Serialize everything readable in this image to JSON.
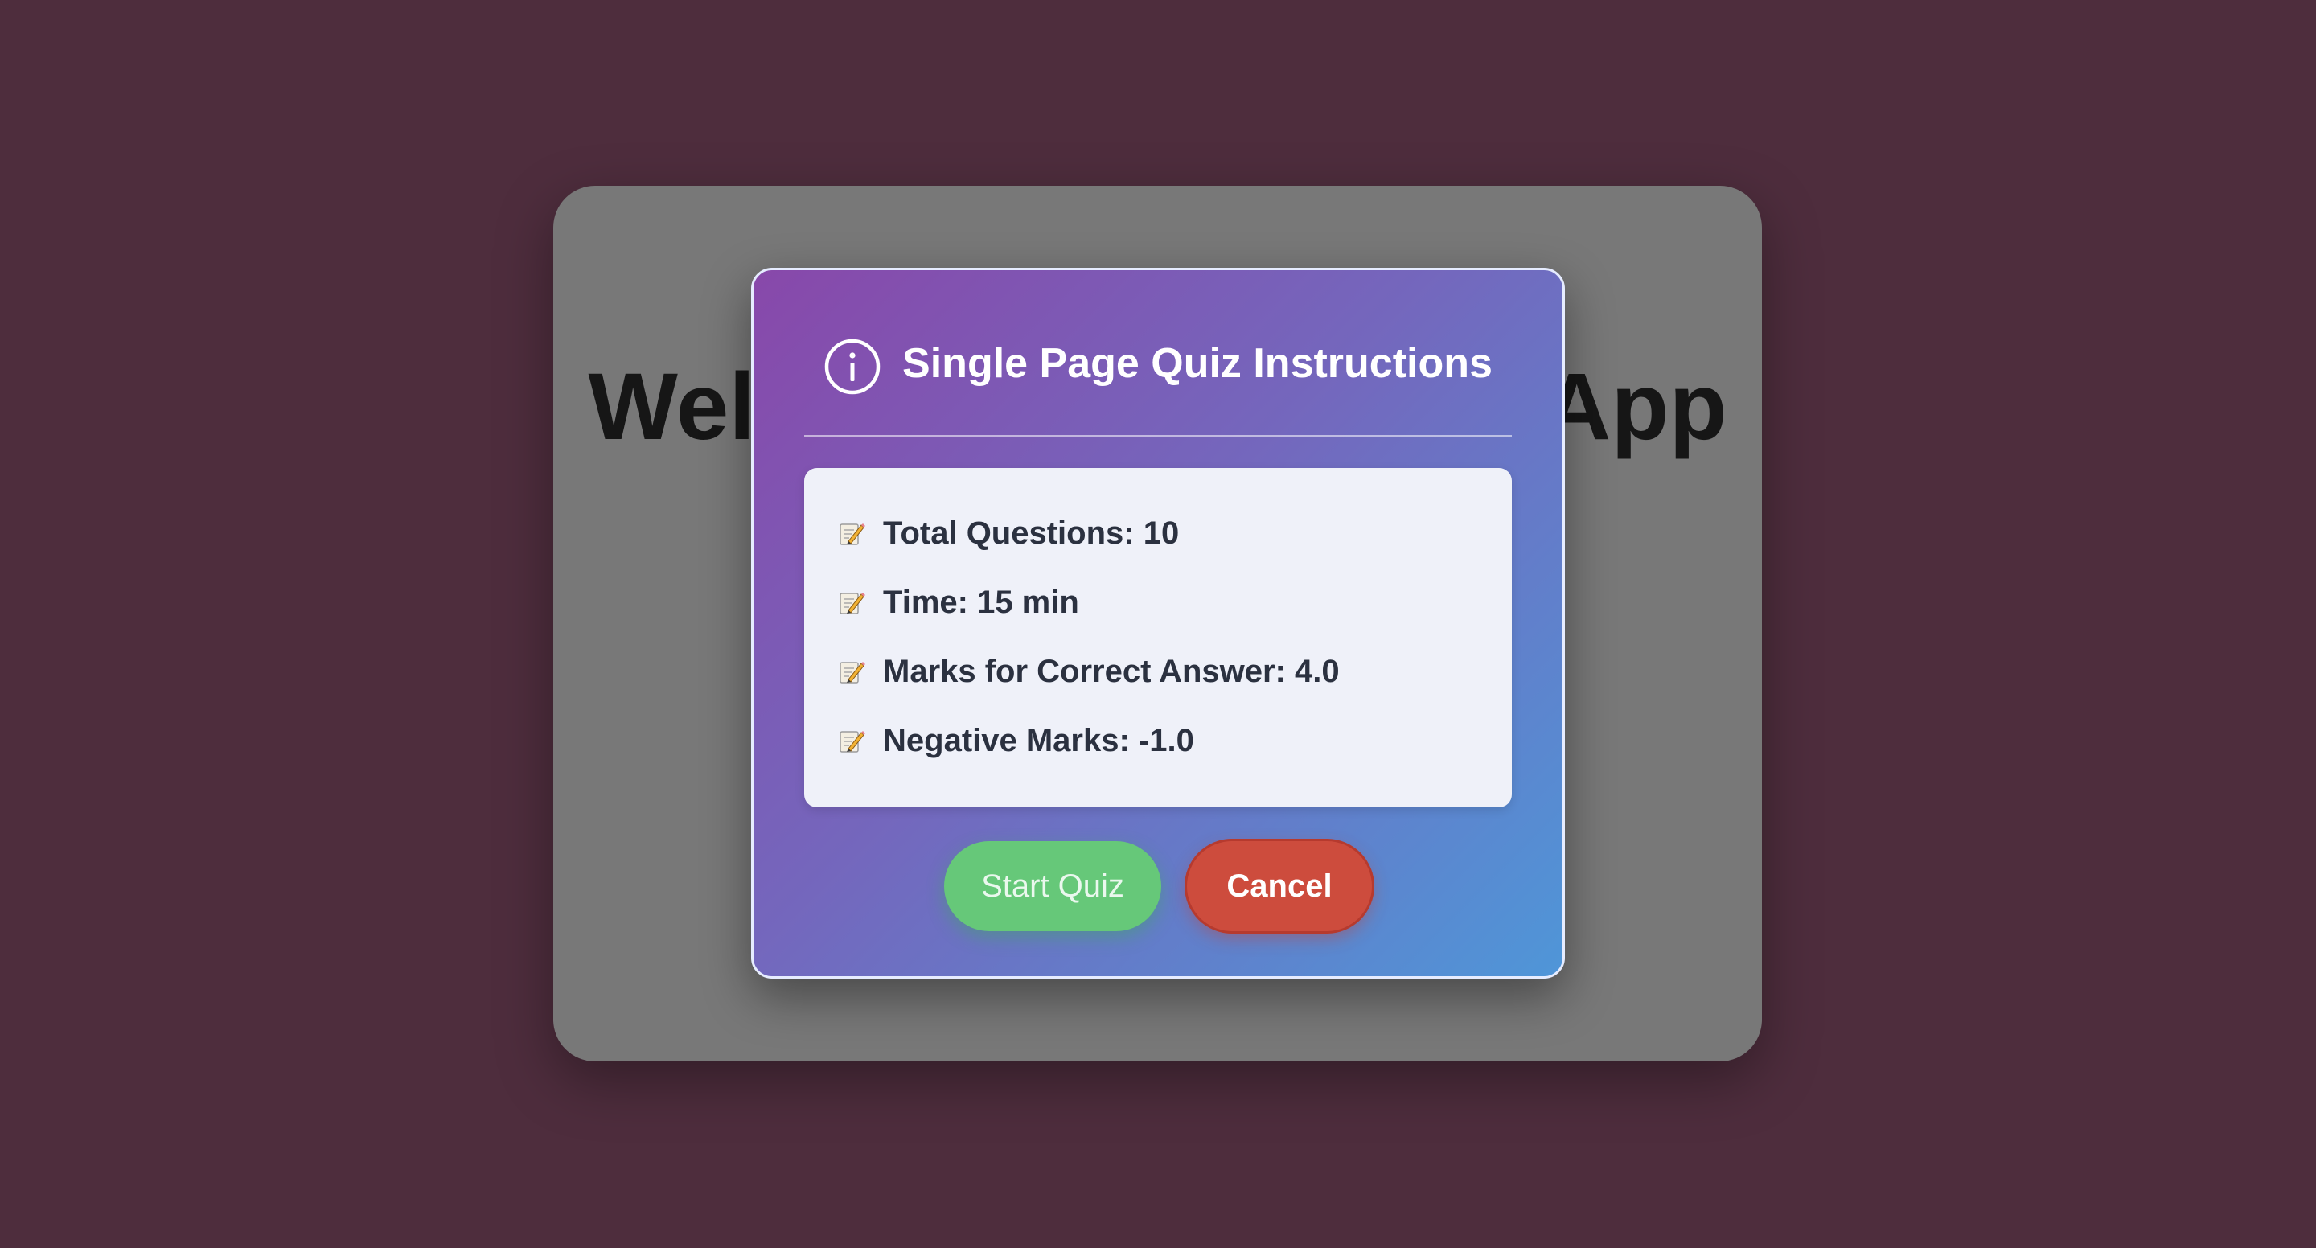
{
  "background": {
    "title": "Welcome to the Quiz App"
  },
  "modal": {
    "icon": "info-icon",
    "title": "Single Page Quiz Instructions",
    "items": [
      {
        "icon": "memo-pencil-icon",
        "text": "Total Questions: 10"
      },
      {
        "icon": "memo-pencil-icon",
        "text": "Time: 15 min"
      },
      {
        "icon": "memo-pencil-icon",
        "text": "Marks for Correct Answer: 4.0"
      },
      {
        "icon": "memo-pencil-icon",
        "text": "Negative Marks: -1.0"
      }
    ],
    "start_label": "Start Quiz",
    "cancel_label": "Cancel"
  },
  "colors": {
    "page_background": "#4e2d3d",
    "card_overlay": "#787878",
    "modal_gradient_start": "#8848aa",
    "modal_gradient_end": "#4f96d8",
    "start_button": "#66c879",
    "cancel_button": "#cd4c3d"
  }
}
